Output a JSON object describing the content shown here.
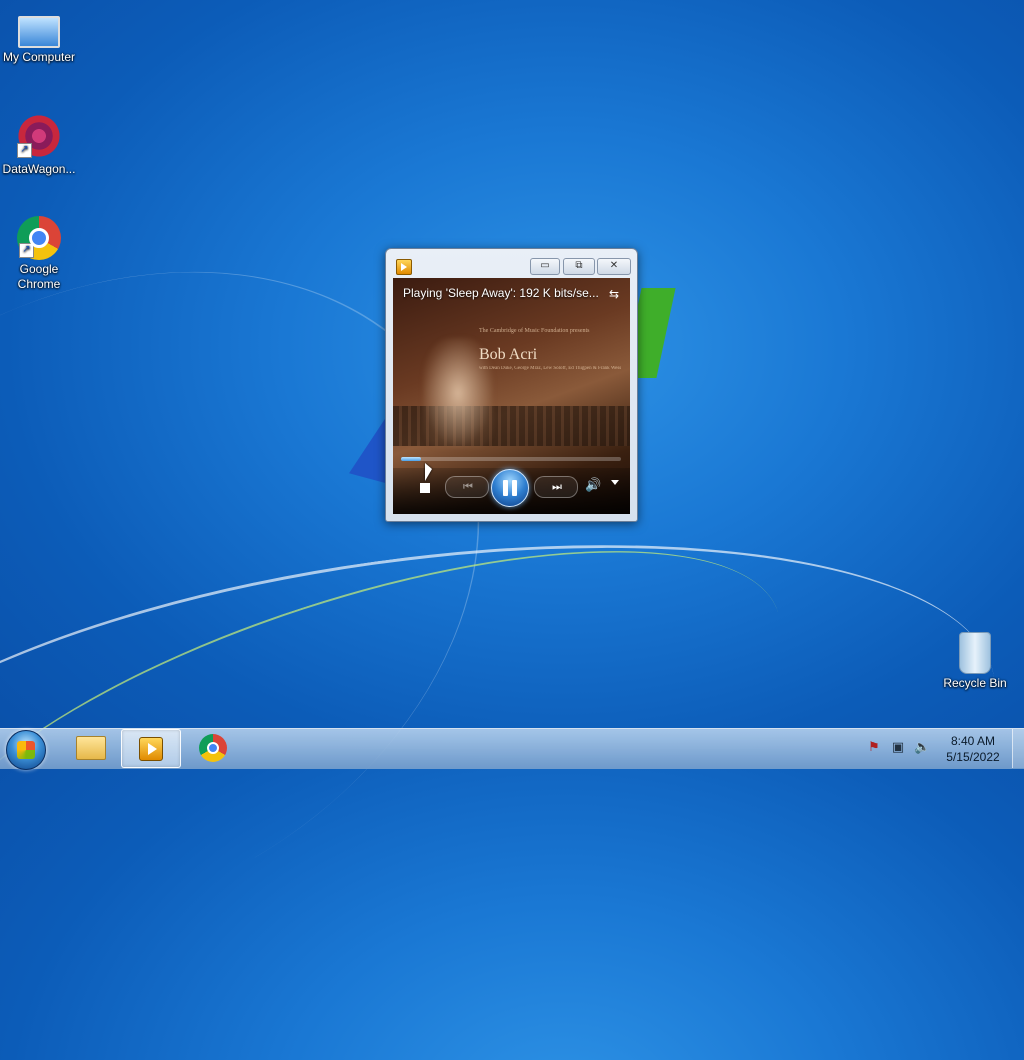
{
  "desktop": {
    "icons": [
      {
        "label": "My Computer",
        "icon": "computer-icon"
      },
      {
        "label": "DataWagon...",
        "icon": "datawagon-icon"
      },
      {
        "label": "Google Chrome",
        "icon": "chrome-icon"
      },
      {
        "label": "Recycle Bin",
        "icon": "recycle-bin-icon"
      }
    ]
  },
  "media_player": {
    "status": "Playing 'Sleep Away': 192 K bits/se...",
    "album_art": {
      "small_text": "The Cambridge of Music Foundation presents",
      "title": "Bob Acri",
      "subtitle": "with Dean Duke, George Mraz, Lew Soloff, Ed Thigpen & Frank Wess"
    },
    "progress": 0.09,
    "caption_buttons": {
      "minimize": "▭",
      "restore": "⧉",
      "close": "✕"
    },
    "controls": {
      "prev": "⏮",
      "next": "⏭",
      "volume": "🔊"
    }
  },
  "taskbar": {
    "buttons": [
      {
        "icon": "windows-explorer-icon",
        "active": false
      },
      {
        "icon": "windows-media-player-icon",
        "active": true
      },
      {
        "icon": "google-chrome-icon",
        "active": false
      }
    ],
    "clock": {
      "time": "8:40 AM",
      "date": "5/15/2022"
    }
  }
}
